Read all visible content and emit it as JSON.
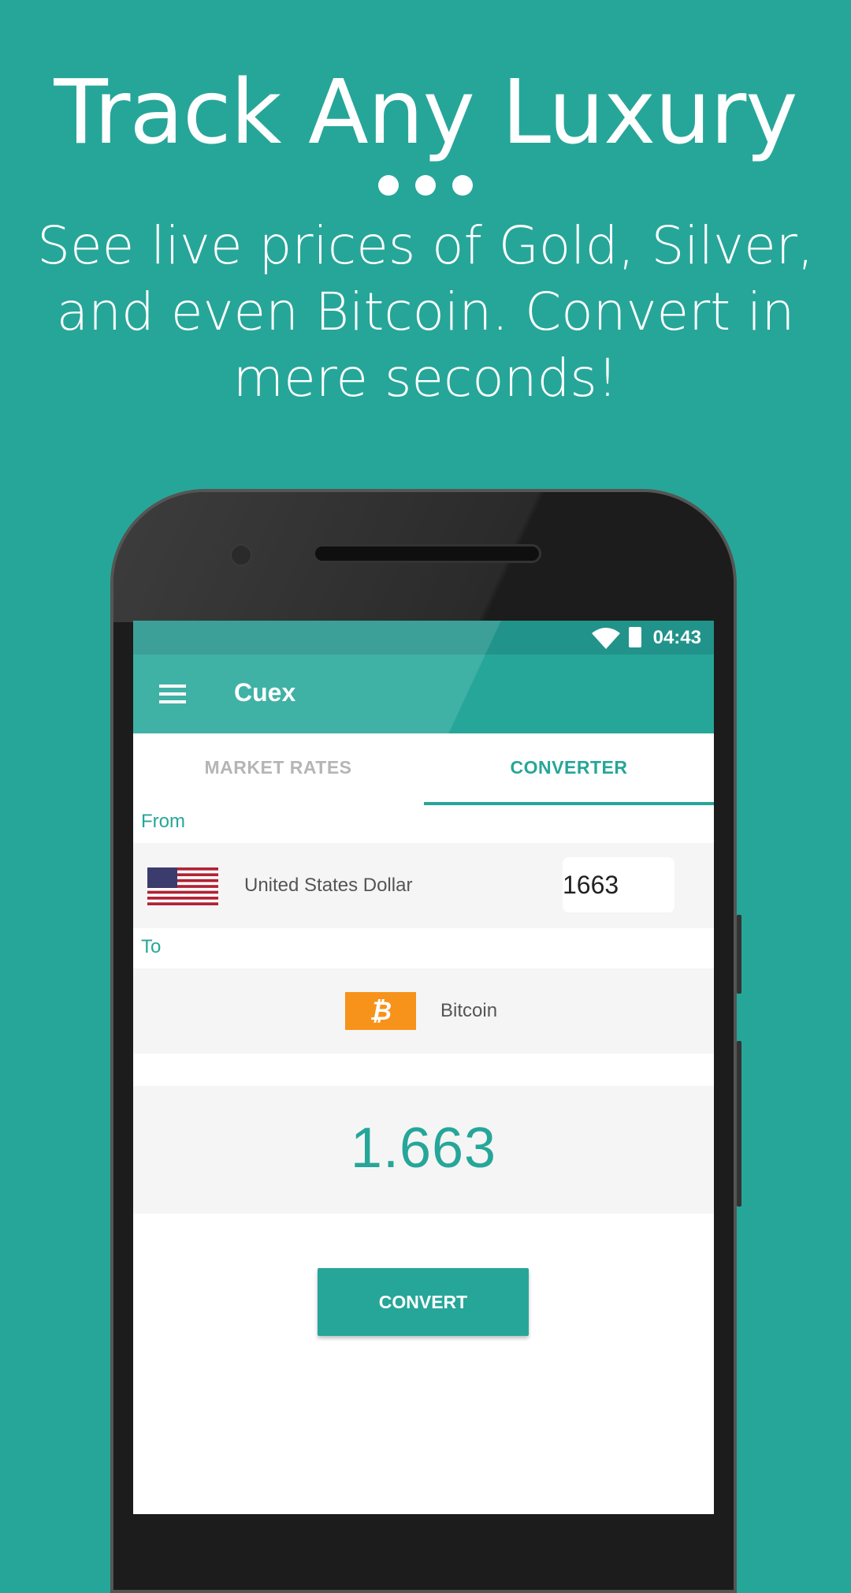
{
  "headline": "Track Any Luxury",
  "subline": "See live prices of Gold, Silver, and even Bitcoin. Convert in mere seconds!",
  "status_bar": {
    "time": "04:43"
  },
  "app_bar": {
    "title": "Cuex",
    "menu_icon": "hamburger-menu-icon"
  },
  "tabs": [
    {
      "label": "MARKET RATES",
      "active": false
    },
    {
      "label": "CONVERTER",
      "active": true
    }
  ],
  "converter": {
    "from_label": "From",
    "from_currency": "United States Dollar",
    "from_flag_icon": "us-flag-icon",
    "amount": "1663",
    "to_label": "To",
    "to_currency": "Bitcoin",
    "to_icon": "bitcoin-icon",
    "to_icon_glyph": "₿",
    "result": "1.663",
    "convert_button": "CONVERT"
  },
  "colors": {
    "accent": "#26a699",
    "status_bar": "#21938a",
    "bitcoin": "#f7931a"
  }
}
